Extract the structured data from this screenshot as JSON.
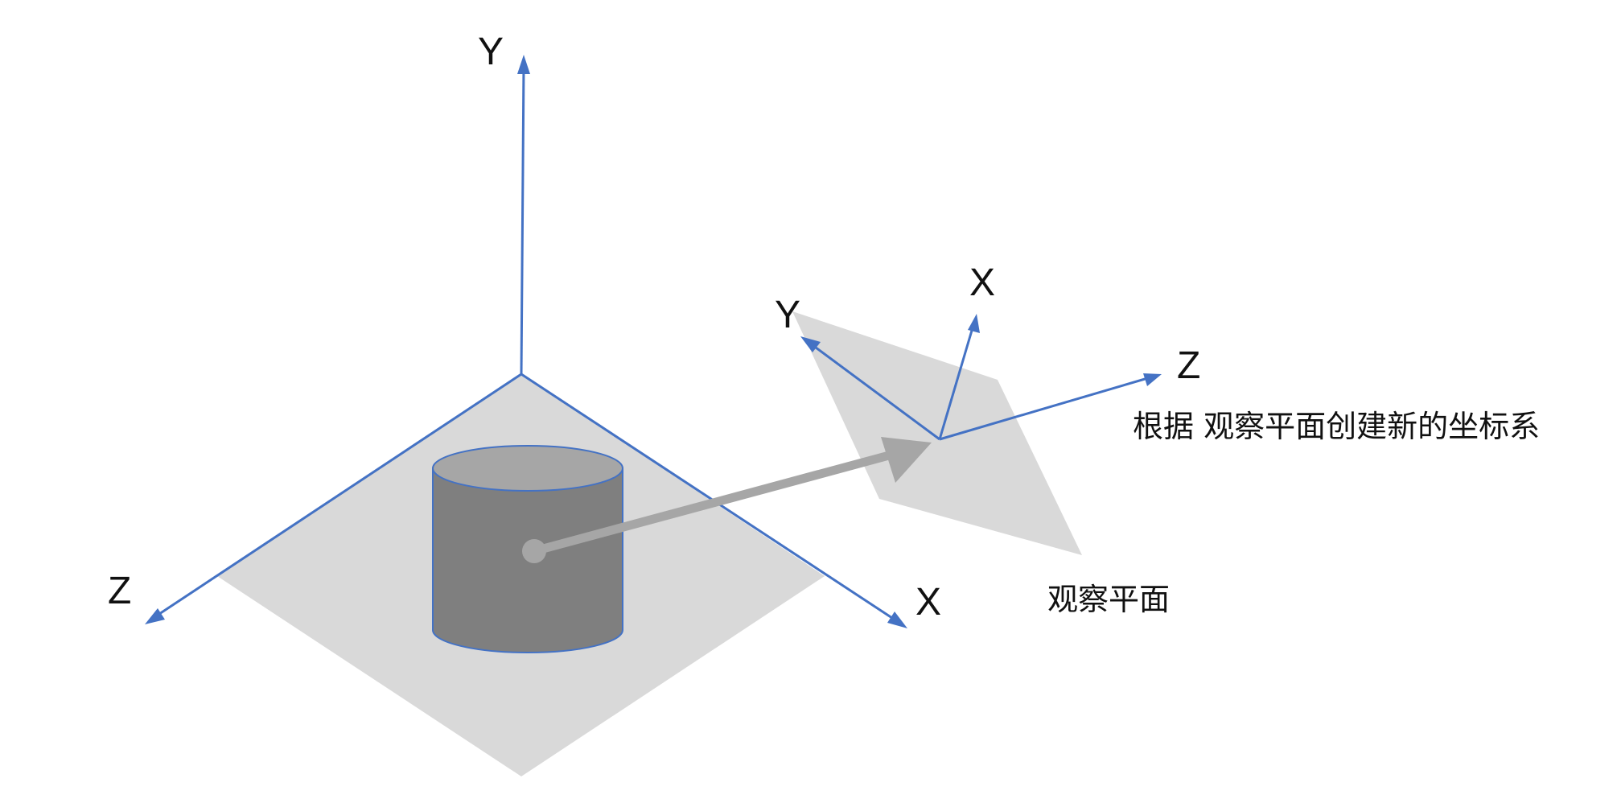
{
  "colors": {
    "axis": "#4472c4",
    "plane": "#d9d9d9",
    "cylinder_body": "#7f7f7f",
    "cylinder_top": "#a6a6a6",
    "projection_arrow": "#a6a6a6",
    "text": "#111111"
  },
  "world_axes": {
    "y_label": "Y",
    "z_label": "Z",
    "x_label": "X"
  },
  "view_axes": {
    "y_label": "Y",
    "x_label": "X",
    "z_label": "Z"
  },
  "captions": {
    "new_coordinate_system": "根据 观察平面创建新的坐标系",
    "view_plane": "观察平面"
  }
}
